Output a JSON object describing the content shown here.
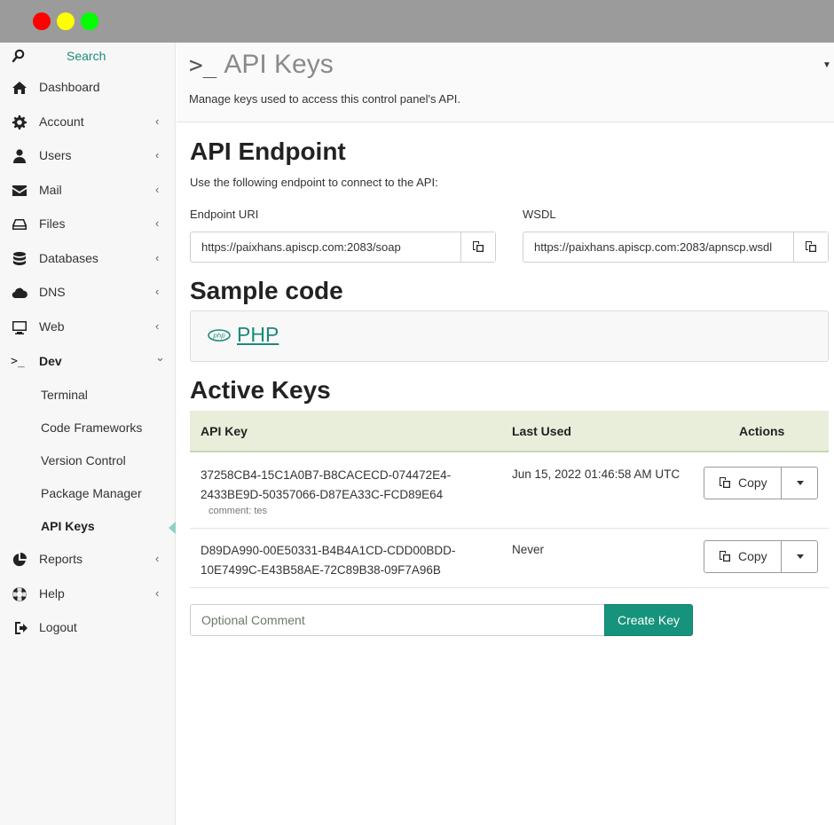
{
  "window": {
    "controls": [
      "close",
      "minimize",
      "maximize"
    ]
  },
  "sidebar": {
    "search_label": "Search",
    "items": [
      {
        "label": "Dashboard",
        "icon": "home-icon",
        "chevron": ""
      },
      {
        "label": "Account",
        "icon": "gear-icon",
        "chevron": "‹"
      },
      {
        "label": "Users",
        "icon": "user-icon",
        "chevron": "‹"
      },
      {
        "label": "Mail",
        "icon": "mail-icon",
        "chevron": "‹"
      },
      {
        "label": "Files",
        "icon": "drive-icon",
        "chevron": "‹"
      },
      {
        "label": "Databases",
        "icon": "database-icon",
        "chevron": "‹"
      },
      {
        "label": "DNS",
        "icon": "cloud-icon",
        "chevron": "‹"
      },
      {
        "label": "Web",
        "icon": "monitor-icon",
        "chevron": "‹"
      },
      {
        "label": "Dev",
        "icon": "terminal-icon",
        "chevron": "⌄"
      }
    ],
    "dev_children": [
      {
        "label": "Terminal"
      },
      {
        "label": "Code Frameworks"
      },
      {
        "label": "Version Control"
      },
      {
        "label": "Package Manager"
      },
      {
        "label": "API Keys"
      }
    ],
    "bottom_items": [
      {
        "label": "Reports",
        "icon": "pie-chart-icon",
        "chevron": "‹"
      },
      {
        "label": "Help",
        "icon": "lifebuoy-icon",
        "chevron": "‹"
      },
      {
        "label": "Logout",
        "icon": "logout-icon",
        "chevron": ""
      }
    ]
  },
  "header": {
    "prompt": ">_",
    "title": "API Keys",
    "description": "Manage keys used to access this control panel's API."
  },
  "endpoint": {
    "heading": "API Endpoint",
    "description": "Use the following endpoint to connect to the API:",
    "uri_label": "Endpoint URI",
    "uri_value": "https://paixhans.apiscp.com:2083/soap",
    "wsdl_label": "WSDL",
    "wsdl_value": "https://paixhans.apiscp.com:2083/apnscp.wsdl"
  },
  "sample": {
    "heading": "Sample code",
    "link_label": "PHP"
  },
  "keys": {
    "heading": "Active Keys",
    "columns": [
      "API Key",
      "Last Used",
      "Actions"
    ],
    "rows": [
      {
        "key_line1": "37258CB4-15C1A0B7-B8CACECD-074472E4-",
        "key_line2": "2433BE9D-50357066-D87EA33C-FCD89E64",
        "comment": "comment: tes",
        "last_used": "Jun 15, 2022 01:46:58 AM UTC",
        "copy_label": "Copy"
      },
      {
        "key_line1": "D89DA990-00E50331-B4B4A1CD-CDD00BDD-",
        "key_line2": "10E7499C-E43B58AE-72C89B38-09F7A96B",
        "comment": "",
        "last_used": "Never",
        "copy_label": "Copy"
      }
    ]
  },
  "create": {
    "placeholder": "Optional Comment",
    "button_label": "Create Key"
  },
  "colors": {
    "accent": "#16937c",
    "link": "#1b8a78",
    "table_header": "#e8eed9"
  }
}
